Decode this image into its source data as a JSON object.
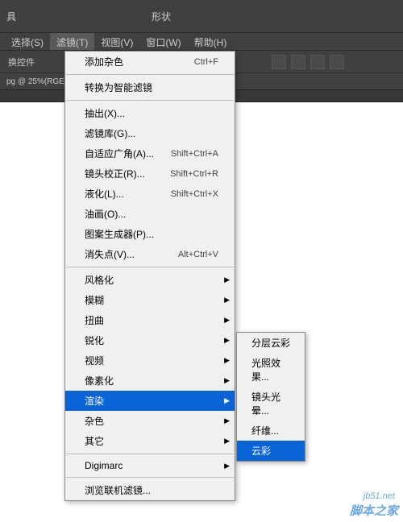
{
  "top": {
    "shape_label": "形状",
    "tools_fragment": "具"
  },
  "menubar": {
    "items": [
      "选择(S)",
      "滤镜(T)",
      "视图(V)",
      "窗口(W)",
      "帮助(H)"
    ],
    "active_index": 1
  },
  "toolbar": {
    "controls_label": "换控件"
  },
  "doc_tab": {
    "label": "pg @ 25%(RGE"
  },
  "filter_menu": {
    "group1": [
      {
        "label": "添加杂色",
        "shortcut": "Ctrl+F"
      }
    ],
    "group2": [
      {
        "label": "转换为智能滤镜"
      }
    ],
    "group3": [
      {
        "label": "抽出(X)..."
      },
      {
        "label": "滤镜库(G)..."
      },
      {
        "label": "自适应广角(A)...",
        "shortcut": "Shift+Ctrl+A"
      },
      {
        "label": "镜头校正(R)...",
        "shortcut": "Shift+Ctrl+R"
      },
      {
        "label": "液化(L)...",
        "shortcut": "Shift+Ctrl+X"
      },
      {
        "label": "油画(O)..."
      },
      {
        "label": "图案生成器(P)..."
      },
      {
        "label": "消失点(V)...",
        "shortcut": "Alt+Ctrl+V"
      }
    ],
    "group4": [
      {
        "label": "风格化",
        "arrow": true
      },
      {
        "label": "模糊",
        "arrow": true
      },
      {
        "label": "扭曲",
        "arrow": true
      },
      {
        "label": "锐化",
        "arrow": true
      },
      {
        "label": "视频",
        "arrow": true
      },
      {
        "label": "像素化",
        "arrow": true
      },
      {
        "label": "渲染",
        "arrow": true,
        "highlighted": true
      },
      {
        "label": "杂色",
        "arrow": true
      },
      {
        "label": "其它",
        "arrow": true
      }
    ],
    "group5": [
      {
        "label": "Digimarc",
        "arrow": true
      }
    ],
    "group6": [
      {
        "label": "浏览联机滤镜..."
      }
    ]
  },
  "render_submenu": {
    "items": [
      {
        "label": "分层云彩"
      },
      {
        "label": "光照效果..."
      },
      {
        "label": "镜头光晕..."
      },
      {
        "label": "纤维..."
      },
      {
        "label": "云彩",
        "highlighted": true
      }
    ]
  },
  "watermark": {
    "url": "jb51.net",
    "text": "脚本之家"
  }
}
